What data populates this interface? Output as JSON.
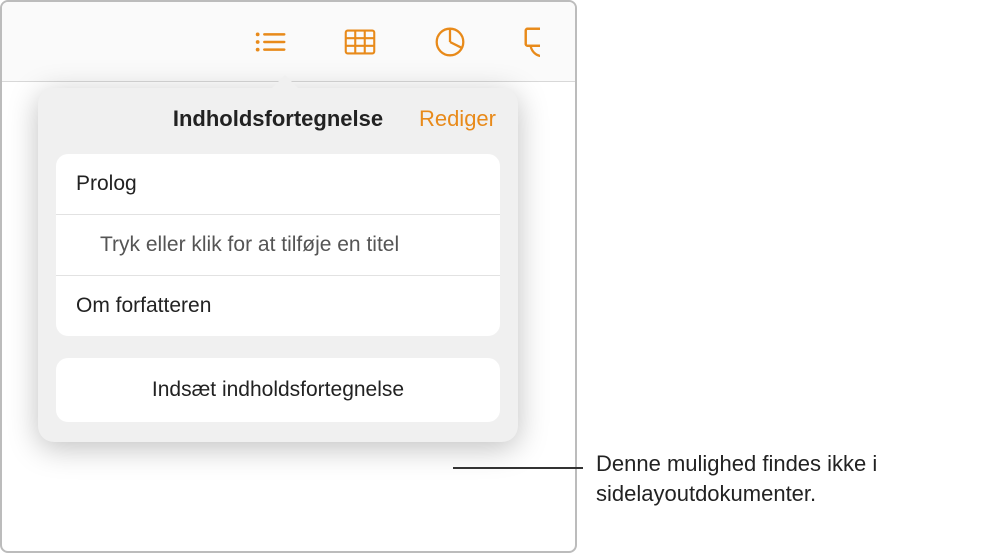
{
  "popover": {
    "title": "Indholdsfortegnelse",
    "edit_label": "Rediger",
    "items": [
      {
        "label": "Prolog"
      },
      {
        "label": "Tryk eller klik for at tilføje en titel"
      },
      {
        "label": "Om forfatteren"
      }
    ],
    "insert_label": "Indsæt indholdsfortegnelse"
  },
  "callout": {
    "text": "Denne mulighed findes ikke i sidelayoutdokumenter."
  }
}
